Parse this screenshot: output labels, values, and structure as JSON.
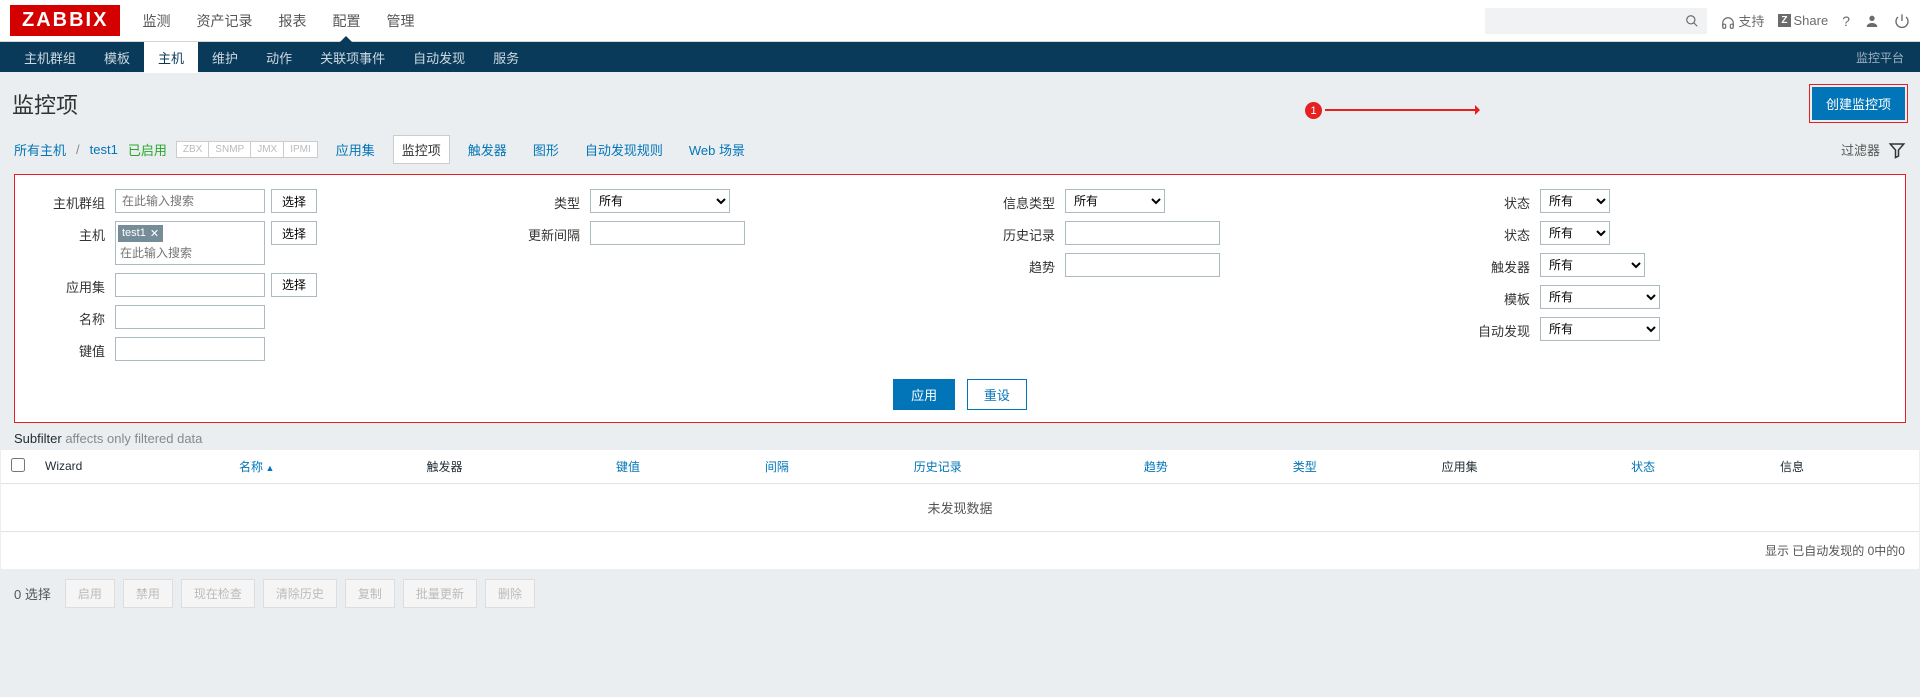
{
  "logo": "ZABBIX",
  "topnav": [
    "监测",
    "资产记录",
    "报表",
    "配置",
    "管理"
  ],
  "topnav_active": 3,
  "search_placeholder": "",
  "support": "支持",
  "share": "Share",
  "subnav": [
    "主机群组",
    "模板",
    "主机",
    "维护",
    "动作",
    "关联项事件",
    "自动发现",
    "服务"
  ],
  "subnav_active": 2,
  "subnav_right": "监控平台",
  "page_title": "监控项",
  "create_button": "创建监控项",
  "annot_num": "1",
  "breadcrumb": {
    "all_hosts": "所有主机",
    "host": "test1",
    "status": "已启用"
  },
  "proto_tags": [
    "ZBX",
    "SNMP",
    "JMX",
    "IPMI"
  ],
  "host_tabs": [
    "应用集",
    "监控项",
    "触发器",
    "图形",
    "自动发现规则",
    "Web 场景"
  ],
  "host_tab_active": 1,
  "filter_label": "过滤器",
  "filter": {
    "host_group": {
      "label": "主机群组",
      "placeholder": "在此输入搜索",
      "select": "选择"
    },
    "host": {
      "label": "主机",
      "tag": "test1",
      "placeholder": "在此输入搜索",
      "select": "选择"
    },
    "application": {
      "label": "应用集",
      "select": "选择"
    },
    "name": {
      "label": "名称"
    },
    "key": {
      "label": "键值"
    },
    "type": {
      "label": "类型",
      "value": "所有"
    },
    "interval": {
      "label": "更新间隔"
    },
    "info_type": {
      "label": "信息类型",
      "value": "所有"
    },
    "history": {
      "label": "历史记录"
    },
    "trends": {
      "label": "趋势"
    },
    "state": {
      "label": "状态",
      "value": "所有"
    },
    "status": {
      "label": "状态",
      "value": "所有"
    },
    "triggers": {
      "label": "触发器",
      "value": "所有"
    },
    "template": {
      "label": "模板",
      "value": "所有"
    },
    "discovery": {
      "label": "自动发现",
      "value": "所有"
    },
    "apply": "应用",
    "reset": "重设"
  },
  "subfilter": {
    "label": "Subfilter",
    "note": "affects only filtered data"
  },
  "columns": {
    "wizard": "Wizard",
    "name": "名称",
    "triggers": "触发器",
    "key": "键值",
    "interval": "间隔",
    "history": "历史记录",
    "trends": "趋势",
    "type": "类型",
    "applications": "应用集",
    "status": "状态",
    "info": "信息"
  },
  "no_data": "未发现数据",
  "footer": "显示 已自动发现的 0中的0",
  "selected_count": "0 选择",
  "bottom_buttons": [
    "启用",
    "禁用",
    "现在检查",
    "清除历史",
    "复制",
    "批量更新",
    "删除"
  ]
}
